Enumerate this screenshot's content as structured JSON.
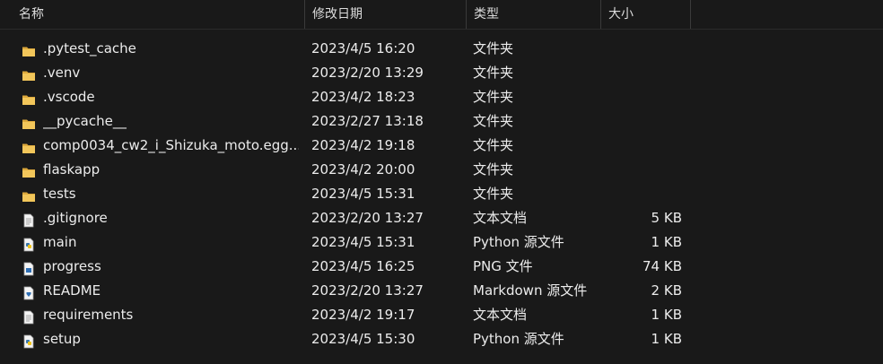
{
  "columns": {
    "name": "名称",
    "date": "修改日期",
    "type": "类型",
    "size": "大小"
  },
  "files": [
    {
      "name": ".pytest_cache",
      "date": "2023/4/5 16:20",
      "type": "文件夹",
      "size": "",
      "icon": "folder-icon"
    },
    {
      "name": ".venv",
      "date": "2023/2/20 13:29",
      "type": "文件夹",
      "size": "",
      "icon": "folder-icon"
    },
    {
      "name": ".vscode",
      "date": "2023/4/2 18:23",
      "type": "文件夹",
      "size": "",
      "icon": "folder-icon"
    },
    {
      "name": "__pycache__",
      "date": "2023/2/27 13:18",
      "type": "文件夹",
      "size": "",
      "icon": "folder-icon"
    },
    {
      "name": "comp0034_cw2_i_Shizuka_moto.egg...",
      "date": "2023/4/2 19:18",
      "type": "文件夹",
      "size": "",
      "icon": "folder-icon"
    },
    {
      "name": "flaskapp",
      "date": "2023/4/2 20:00",
      "type": "文件夹",
      "size": "",
      "icon": "folder-icon"
    },
    {
      "name": "tests",
      "date": "2023/4/5 15:31",
      "type": "文件夹",
      "size": "",
      "icon": "folder-icon"
    },
    {
      "name": ".gitignore",
      "date": "2023/2/20 13:27",
      "type": "文本文档",
      "size": "5 KB",
      "icon": "text-file-icon"
    },
    {
      "name": "main",
      "date": "2023/4/5 15:31",
      "type": "Python 源文件",
      "size": "1 KB",
      "icon": "python-file-icon"
    },
    {
      "name": "progress",
      "date": "2023/4/5 16:25",
      "type": "PNG 文件",
      "size": "74 KB",
      "icon": "image-file-icon"
    },
    {
      "name": "README",
      "date": "2023/2/20 13:27",
      "type": "Markdown 源文件",
      "size": "2 KB",
      "icon": "markdown-file-icon"
    },
    {
      "name": "requirements",
      "date": "2023/4/2 19:17",
      "type": "文本文档",
      "size": "1 KB",
      "icon": "text-file-icon"
    },
    {
      "name": "setup",
      "date": "2023/4/5 15:30",
      "type": "Python 源文件",
      "size": "1 KB",
      "icon": "python-file-icon"
    }
  ],
  "colors": {
    "background": "#191919",
    "folder": "#e8b84a",
    "text": "#ececec"
  }
}
